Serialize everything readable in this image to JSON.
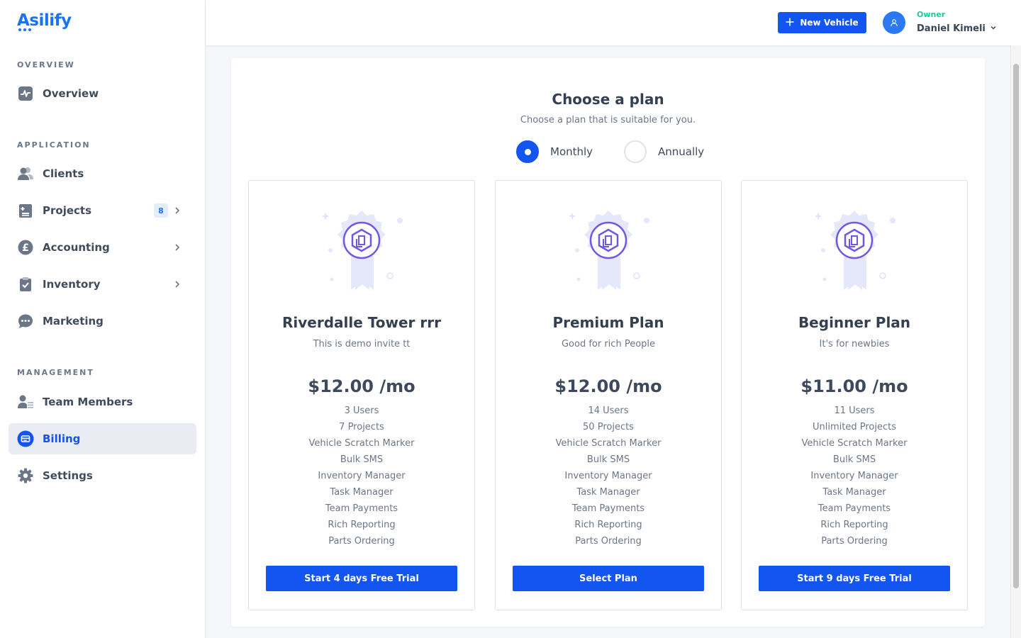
{
  "app": {
    "logo_text": "Asilify",
    "brand_color": "#1a73f0",
    "accent_color": "#1355f0"
  },
  "sidebar": {
    "sections": [
      {
        "title": "OVERVIEW"
      },
      {
        "title": "APPLICATION"
      },
      {
        "title": "MANAGEMENT"
      }
    ],
    "items": [
      {
        "label": "Overview",
        "icon": "pulse-icon"
      },
      {
        "label": "Clients",
        "icon": "users-icon"
      },
      {
        "label": "Projects",
        "icon": "clipboard-list-icon",
        "badge": "8"
      },
      {
        "label": "Accounting",
        "icon": "pound-coin-icon"
      },
      {
        "label": "Inventory",
        "icon": "clipboard-check-icon"
      },
      {
        "label": "Marketing",
        "icon": "chat-bubble-icon"
      },
      {
        "label": "Team Members",
        "icon": "team-list-icon"
      },
      {
        "label": "Billing",
        "icon": "billing-icon",
        "active": true
      },
      {
        "label": "Settings",
        "icon": "gear-icon"
      }
    ]
  },
  "header": {
    "new_vehicle_label": "New Vehicle",
    "user_role": "Owner",
    "user_name": "Daniel Kimeli"
  },
  "main": {
    "title": "Choose a plan",
    "subtitle": "Choose a plan that is suitable for you.",
    "billing_options": [
      {
        "label": "Monthly",
        "selected": true
      },
      {
        "label": "Annually",
        "selected": false
      }
    ],
    "plans": [
      {
        "name": "Riverdalle Tower rrr",
        "description": "This is demo invite tt",
        "price": "$12.00 /mo",
        "features": [
          "3 Users",
          "7 Projects",
          "Vehicle Scratch Marker",
          "Bulk SMS",
          "Inventory Manager",
          "Task Manager",
          "Team Payments",
          "Rich Reporting",
          "Parts Ordering"
        ],
        "button_label": "Start 4 days Free Trial"
      },
      {
        "name": "Premium Plan",
        "description": "Good for rich People",
        "price": "$12.00 /mo",
        "features": [
          "14 Users",
          "50 Projects",
          "Vehicle Scratch Marker",
          "Bulk SMS",
          "Inventory Manager",
          "Task Manager",
          "Team Payments",
          "Rich Reporting",
          "Parts Ordering"
        ],
        "button_label": "Select Plan"
      },
      {
        "name": "Beginner Plan",
        "description": "It's for newbies",
        "price": "$11.00 /mo",
        "features": [
          "11 Users",
          "Unlimited Projects",
          "Vehicle Scratch Marker",
          "Bulk SMS",
          "Inventory Manager",
          "Task Manager",
          "Team Payments",
          "Rich Reporting",
          "Parts Ordering"
        ],
        "button_label": "Start 9 days Free Trial"
      }
    ]
  }
}
